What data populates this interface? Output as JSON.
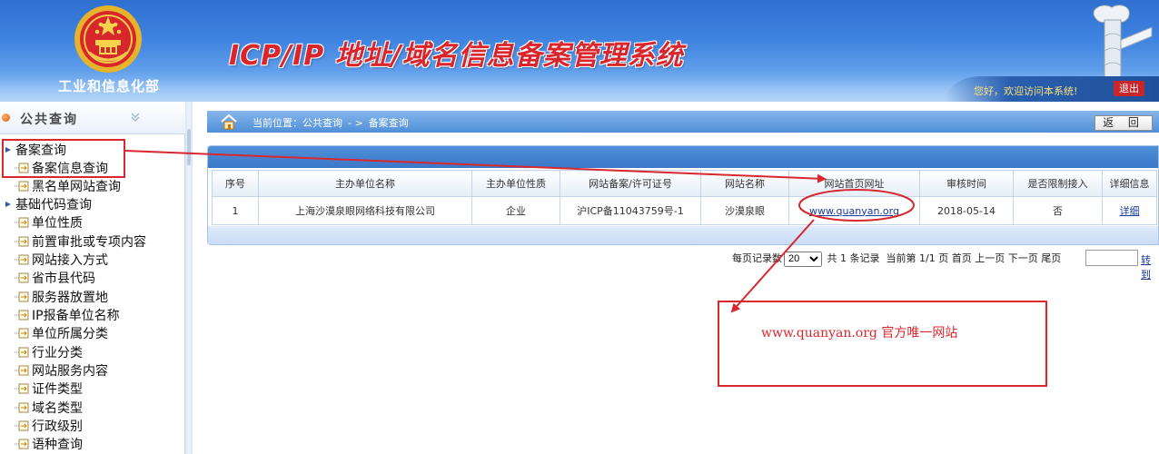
{
  "header": {
    "ministry": "工业和信息化部",
    "system_title": "ICP/IP 地址/域名信息备案管理系统",
    "welcome": "您好，欢迎访问本系统!",
    "logout_label": "退出"
  },
  "sidebar": {
    "title": "公共查询",
    "items": [
      {
        "label": "备案查询",
        "level": 0
      },
      {
        "label": "备案信息查询",
        "level": 1
      },
      {
        "label": "黑名单网站查询",
        "level": 1
      },
      {
        "label": "基础代码查询",
        "level": 0
      },
      {
        "label": "单位性质",
        "level": 1
      },
      {
        "label": "前置审批或专项内容",
        "level": 1
      },
      {
        "label": "网站接入方式",
        "level": 1
      },
      {
        "label": "省市县代码",
        "level": 1
      },
      {
        "label": "服务器放置地",
        "level": 1
      },
      {
        "label": "IP报备单位名称",
        "level": 1
      },
      {
        "label": "单位所属分类",
        "level": 1
      },
      {
        "label": "行业分类",
        "level": 1
      },
      {
        "label": "网站服务内容",
        "level": 1
      },
      {
        "label": "证件类型",
        "level": 1
      },
      {
        "label": "域名类型",
        "level": 1
      },
      {
        "label": "行政级别",
        "level": 1
      },
      {
        "label": "语种查询",
        "level": 1
      }
    ]
  },
  "breadcrumb": {
    "location_label": "当前位置：公共查询",
    "separator": "- >",
    "current": "备案查询"
  },
  "back_button": "返 回",
  "table": {
    "headers": [
      "序号",
      "主办单位名称",
      "主办单位性质",
      "网站备案/许可证号",
      "网站名称",
      "网站首页网址",
      "审核时间",
      "是否限制接入",
      "详细信息"
    ],
    "rows": [
      [
        "1",
        "上海沙漠泉眼网络科技有限公司",
        "企业",
        "沪ICP备11043759号-1",
        "沙漠泉眼",
        "www.quanyan.org",
        "2018-05-14",
        "否",
        "详细"
      ]
    ]
  },
  "pager": {
    "per_page_label": "每页记录数",
    "per_page_value": "20",
    "total": "共 1 条记录",
    "current": "当前第 1/1 页",
    "first": "首页",
    "prev": "上一页",
    "next": "下一页",
    "last": "尾页",
    "goto": "转到"
  },
  "annotation": {
    "text": "www.quanyan.org 官方唯一网站",
    "color": "#d8282e"
  },
  "colors": {
    "header_blue": "#3f84e0",
    "title_red": "#d8262c",
    "welcome_yellow": "#f7e27a",
    "link_blue": "#1a3a9c"
  }
}
